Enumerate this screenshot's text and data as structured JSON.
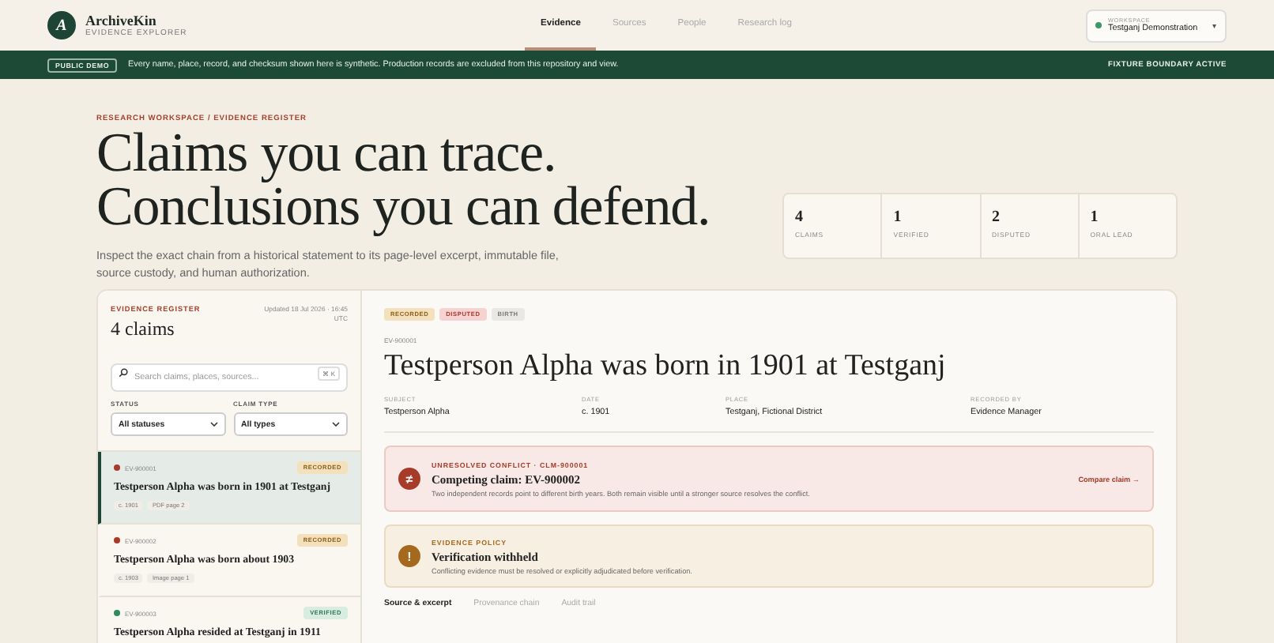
{
  "brand": {
    "mark": "A",
    "name": "ArchiveKin",
    "subtitle": "EVIDENCE EXPLORER"
  },
  "nav": [
    {
      "label": "Evidence",
      "selected": true
    },
    {
      "label": "Sources",
      "selected": false
    },
    {
      "label": "People",
      "selected": false
    },
    {
      "label": "Research log",
      "selected": false
    }
  ],
  "workspace": {
    "label": "WORKSPACE",
    "value": "Testganj Demonstration",
    "caret": "▾"
  },
  "banner": {
    "badge": "PUBLIC DEMO",
    "message": "Every name, place, record, and checksum shown here is synthetic. Production records are excluded from this repository and view.",
    "status": "FIXTURE BOUNDARY ACTIVE"
  },
  "hero": {
    "eyebrow": "RESEARCH WORKSPACE / EVIDENCE REGISTER",
    "title_lines": [
      "Claims you can trace.",
      "Conclusions you can defend."
    ],
    "lead": "Inspect the exact chain from a historical statement to its page-level excerpt, immutable file, source custody, and human authorization."
  },
  "stats": [
    {
      "value": "4",
      "label": "CLAIMS"
    },
    {
      "value": "1",
      "label": "VERIFIED"
    },
    {
      "value": "2",
      "label": "DISPUTED"
    },
    {
      "value": "1",
      "label": "ORAL LEAD"
    }
  ],
  "register": {
    "eyebrow": "EVIDENCE REGISTER",
    "title": "4 claims",
    "updated": "Updated 18 Jul 2026 · 16:45 UTC",
    "search_placeholder": "Search claims, places, sources...",
    "shortcut": "⌘ K",
    "filters": [
      {
        "label": "STATUS",
        "value": "All statuses"
      },
      {
        "label": "CLAIM TYPE",
        "value": "All types"
      }
    ],
    "claims": [
      {
        "id": "EV-900001",
        "status": {
          "label": "RECORDED",
          "kind": "recorded"
        },
        "color": "#a83a2c",
        "title": "Testperson Alpha was born in 1901 at Testganj",
        "tags": [
          "c. 1901",
          "PDF page 2"
        ],
        "selected": true
      },
      {
        "id": "EV-900002",
        "status": {
          "label": "RECORDED",
          "kind": "recorded"
        },
        "color": "#a83a2c",
        "title": "Testperson Alpha was born about 1903",
        "tags": [
          "c. 1903",
          "Image page 1"
        ],
        "selected": false
      },
      {
        "id": "EV-900003",
        "status": {
          "label": "VERIFIED",
          "kind": "verified"
        },
        "color": "#2f8a5c",
        "title": "Testperson Alpha resided at Testganj in 1911",
        "selected": false
      }
    ]
  },
  "detail": {
    "badges": [
      {
        "label": "RECORDED",
        "kind": "recorded"
      },
      {
        "label": "DISPUTED",
        "kind": "disputed"
      },
      {
        "label": "BIRTH",
        "kind": "neutral"
      }
    ],
    "id": "EV-900001",
    "title": "Testperson Alpha was born in 1901 at Testganj",
    "facts": [
      {
        "label": "SUBJECT",
        "value": "Testperson Alpha"
      },
      {
        "label": "DATE",
        "value": "c. 1901"
      },
      {
        "label": "PLACE",
        "value": "Testganj, Fictional District"
      },
      {
        "label": "RECORDED BY",
        "value": "Evidence Manager"
      }
    ],
    "alerts": [
      {
        "kind": "conflict",
        "icon": "≠",
        "eyebrow": "UNRESOLVED CONFLICT · CLM-900001",
        "title": "Competing claim: EV-900002",
        "body": "Two independent records point to different birth years. Both remain visible until a stronger source resolves the conflict.",
        "action": "Compare claim →"
      },
      {
        "kind": "policy",
        "icon": "!",
        "eyebrow": "EVIDENCE POLICY",
        "title": "Verification withheld",
        "body": "Conflicting evidence must be resolved or explicitly adjudicated before verification."
      }
    ],
    "tabs": [
      {
        "label": "Source & excerpt",
        "selected": true
      },
      {
        "label": "Provenance chain",
        "selected": false
      },
      {
        "label": "Audit trail",
        "selected": false
      }
    ]
  }
}
